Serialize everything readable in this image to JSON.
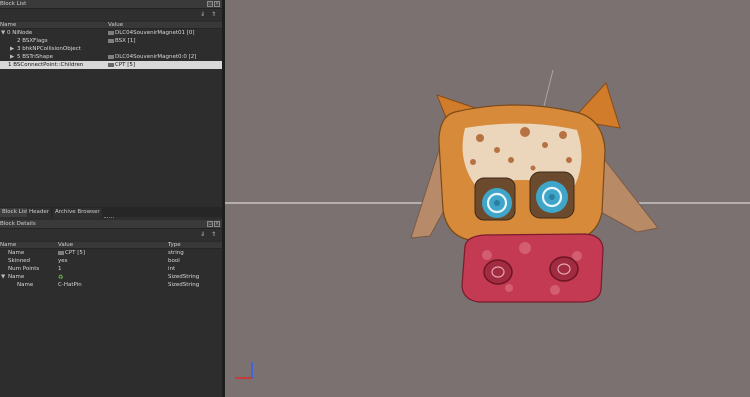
{
  "block_list": {
    "title": "Block List",
    "columns": {
      "name": "Name",
      "value": "Value"
    },
    "rows": [
      {
        "expander": "▼",
        "name": "0 NiNode",
        "value": "DLC04SouvenirMagnet01 [0]"
      },
      {
        "expander": "",
        "name": "2 BSXFlags",
        "value": "BSX [1]"
      },
      {
        "expander": "▶",
        "name": "3 bhkNPCollisionObject",
        "value": ""
      },
      {
        "expander": "▶",
        "name": "5 BSTriShape",
        "value": "DLC04SouvenirMagnet0:0 [2]"
      },
      {
        "expander": "",
        "name": "1 BSConnectPoint::Children",
        "value": "CPT [5]"
      }
    ]
  },
  "tabs": [
    "Block List",
    "Header",
    "Archive Browser"
  ],
  "block_details": {
    "title": "Block Details",
    "columns": {
      "name": "Name",
      "value": "Value",
      "type": "Type"
    },
    "rows": [
      {
        "expander": "",
        "name": "Name",
        "value": "CPT [5]",
        "type": "string"
      },
      {
        "expander": "",
        "name": "Skinned",
        "value": "yes",
        "type": "bool"
      },
      {
        "expander": "",
        "name": "Num Points",
        "value": "1",
        "type": "int"
      },
      {
        "expander": "▼",
        "name": "Name",
        "value": "",
        "type": "SizedString"
      },
      {
        "expander": "",
        "name": "Name",
        "value": "C-HatPin",
        "type": "SizedString"
      }
    ]
  },
  "icons": {
    "float": "float-icon",
    "close": "close-icon",
    "collapse": "collapse-icon",
    "expand": "expand-icon"
  },
  "colors": {
    "viewport_bg": "#7b7170",
    "selection": "#d9d9d9",
    "panel_bg": "#2d2d2d"
  }
}
